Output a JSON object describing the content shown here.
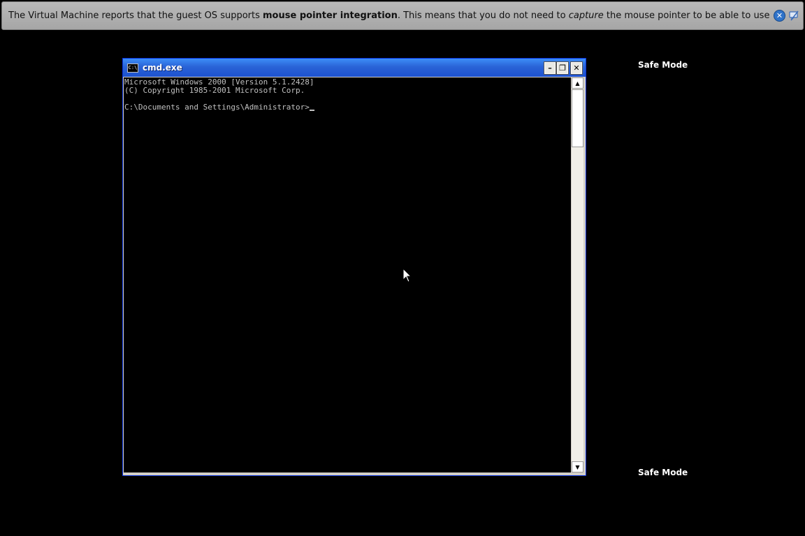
{
  "banner": {
    "text_1": "The Virtual Machine reports that the guest OS supports ",
    "bold": "mouse pointer integration",
    "text_2": ". This means that you do not need to ",
    "italic": "capture",
    "text_3": " the mouse pointer to be able to use it in your guest OS -- "
  },
  "cmd": {
    "title": "cmd.exe",
    "icon_text": "C:\\",
    "buttons": {
      "minimize": "–",
      "restore": "❐",
      "close": "✕"
    },
    "lines": [
      "Microsoft Windows 2000 [Version 5.1.2428]",
      "(C) Copyright 1985-2001 Microsoft Corp.",
      "",
      "C:\\Documents and Settings\\Administrator>"
    ]
  },
  "desktop": {
    "safe_mode_top": "Safe Mode",
    "safe_mode_bottom": "Safe Mode"
  }
}
